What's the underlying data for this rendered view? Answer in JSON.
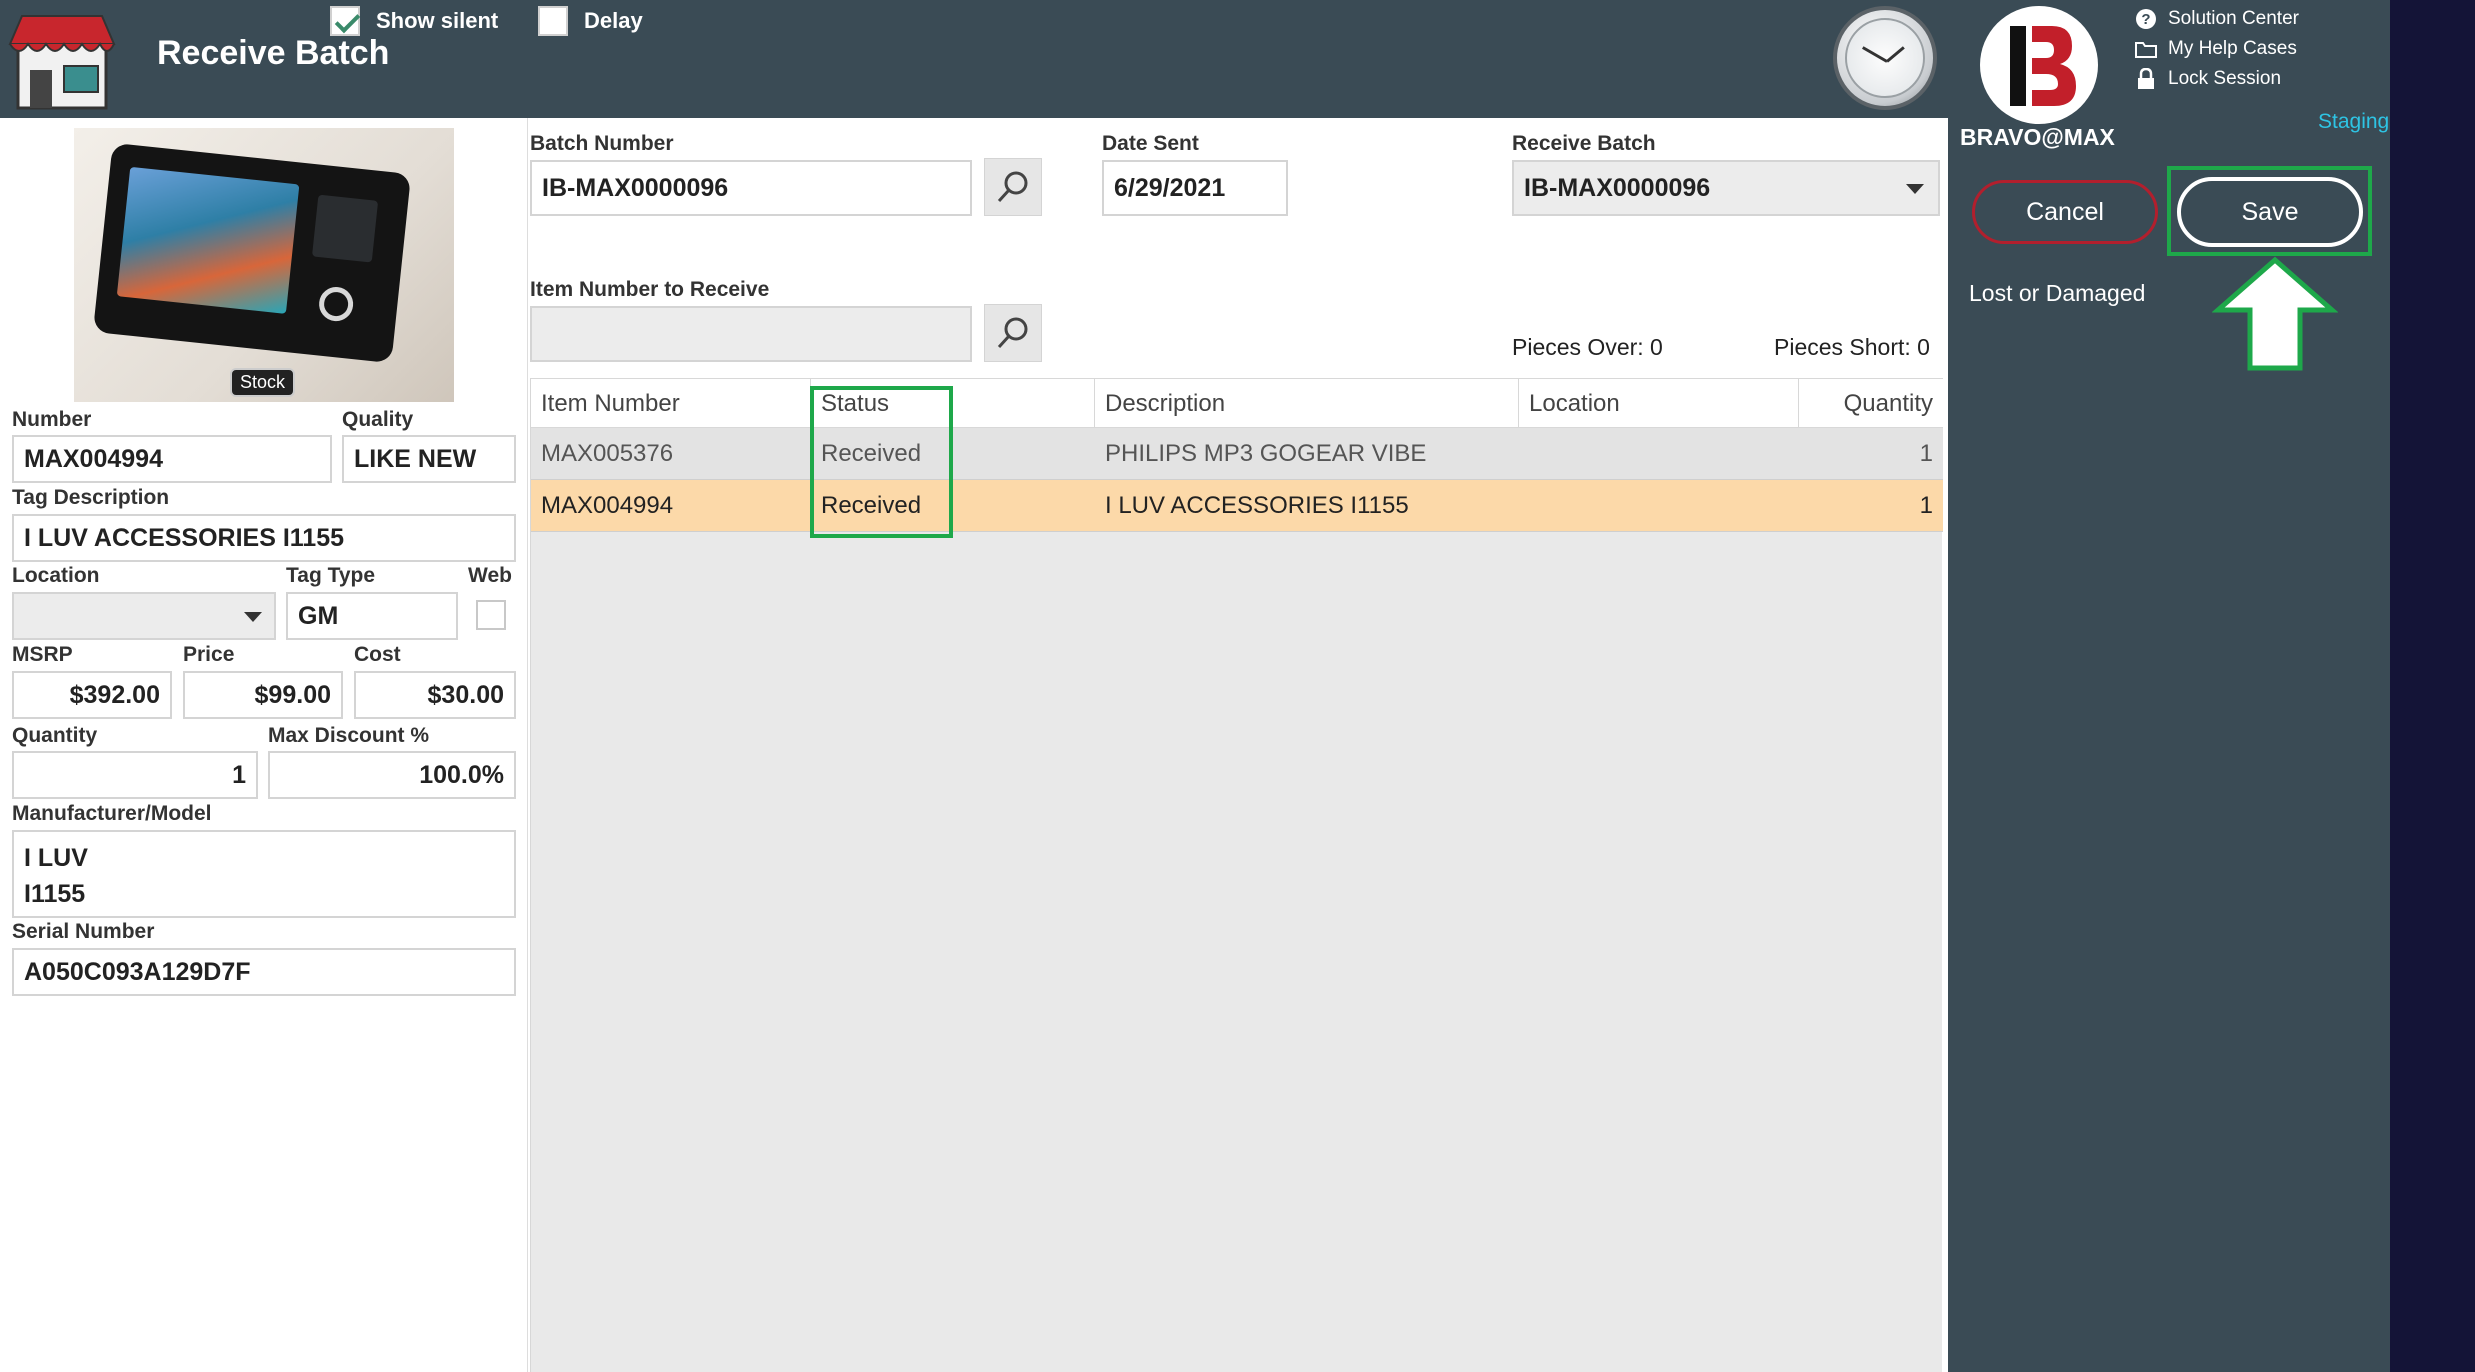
{
  "header": {
    "title": "Receive Batch",
    "show_silent_label": "Show silent",
    "show_silent_checked": true,
    "delay_label": "Delay",
    "delay_checked": false
  },
  "sidebar": {
    "brand_name": "BRAVO@MAX",
    "help_links": [
      "Solution Center",
      "My Help Cases",
      "Lock Session"
    ],
    "environment": "Staging",
    "cancel_label": "Cancel",
    "save_label": "Save",
    "lost_damaged_label": "Lost or Damaged"
  },
  "item": {
    "photo_badge": "Stock",
    "number_label": "Number",
    "number": "MAX004994",
    "quality_label": "Quality",
    "quality": "LIKE NEW",
    "tag_description_label": "Tag Description",
    "tag_description": "I LUV ACCESSORIES I1155",
    "location_label": "Location",
    "location": "",
    "tag_type_label": "Tag Type",
    "tag_type": "GM",
    "web_label": "Web",
    "msrp_label": "MSRP",
    "msrp": "$392.00",
    "price_label": "Price",
    "price": "$99.00",
    "cost_label": "Cost",
    "cost": "$30.00",
    "quantity_label": "Quantity",
    "quantity": "1",
    "max_discount_label": "Max Discount %",
    "max_discount": "100.0%",
    "manufacturer_label": "Manufacturer/Model",
    "manufacturer": "I LUV",
    "model": "I1155",
    "serial_label": "Serial Number",
    "serial": "A050C093A129D7F"
  },
  "batch": {
    "batch_number_label": "Batch Number",
    "batch_number": "IB-MAX0000096",
    "date_sent_label": "Date Sent",
    "date_sent": "6/29/2021",
    "receive_batch_label": "Receive Batch",
    "receive_batch": "IB-MAX0000096",
    "item_to_receive_label": "Item Number to Receive",
    "item_to_receive": "",
    "pieces_over": "Pieces Over: 0",
    "pieces_short": "Pieces Short: 0"
  },
  "grid": {
    "columns": [
      "Item Number",
      "Status",
      "Description",
      "Location",
      "Quantity"
    ],
    "rows": [
      {
        "item_number": "MAX005376",
        "status": "Received",
        "description": "PHILIPS MP3 GOGEAR VIBE",
        "location": "",
        "quantity": "1"
      },
      {
        "item_number": "MAX004994",
        "status": "Received",
        "description": "I LUV ACCESSORIES I1155",
        "location": "",
        "quantity": "1"
      }
    ]
  }
}
